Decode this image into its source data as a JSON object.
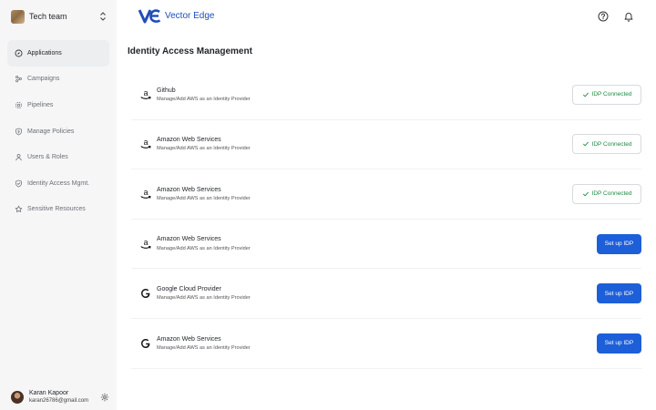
{
  "team": {
    "name": "Tech team",
    "avatar_icon": "team-avatar-image"
  },
  "nav": [
    {
      "label": "Applications",
      "icon": "compass-icon",
      "active": true
    },
    {
      "label": "Campaigns",
      "icon": "share-nodes-icon",
      "active": false
    },
    {
      "label": "Pipelines",
      "icon": "settings-cog-icon",
      "active": false
    },
    {
      "label": "Manage Policies",
      "icon": "shield-dollar-icon",
      "active": false
    },
    {
      "label": "Users & Roles",
      "icon": "user-icon",
      "active": false
    },
    {
      "label": "Identity Access Mgmt.",
      "icon": "shield-check-icon",
      "active": false
    },
    {
      "label": "Sensitive Resources",
      "icon": "star-icon",
      "active": false
    }
  ],
  "user": {
    "name": "Karan Kapoor",
    "email": "karan26786@gmail.com"
  },
  "brand": {
    "name": "Vector Edge",
    "color": "#1f4db8"
  },
  "header_icons": [
    "help-circle-icon",
    "bell-icon"
  ],
  "page_title": "Identity Access Management",
  "providers": [
    {
      "name": "Github",
      "subtitle": "Manage/Add AWS as an Identity Provider",
      "icon": "amazon-icon",
      "status": "connected",
      "action_label": "IDP Connected"
    },
    {
      "name": "Amazon Web Services",
      "subtitle": "Manage/Add AWS as an Identity Provider",
      "icon": "amazon-icon",
      "status": "connected",
      "action_label": "IDP Connected"
    },
    {
      "name": "Amazon Web Services",
      "subtitle": "Manage/Add AWS as an Identity Provider",
      "icon": "amazon-icon",
      "status": "connected",
      "action_label": "IDP Connected"
    },
    {
      "name": "Amazon Web Services",
      "subtitle": "Manage/Add AWS as an Identity Provider",
      "icon": "amazon-icon",
      "status": "setup",
      "action_label": "Set up IDP"
    },
    {
      "name": "Google Cloud Provider",
      "subtitle": "Manage/Add AWS as an Identity Provider",
      "icon": "google-icon",
      "status": "setup",
      "action_label": "Set up IDP"
    },
    {
      "name": "Amazon Web Services",
      "subtitle": "Manage/Add AWS as an Identity Provider",
      "icon": "google-icon",
      "status": "setup",
      "action_label": "Set up IDP"
    }
  ],
  "colors": {
    "primary": "#1d5fd8",
    "success": "#1f8a3f",
    "sidebar_bg": "#f6f6f7"
  }
}
